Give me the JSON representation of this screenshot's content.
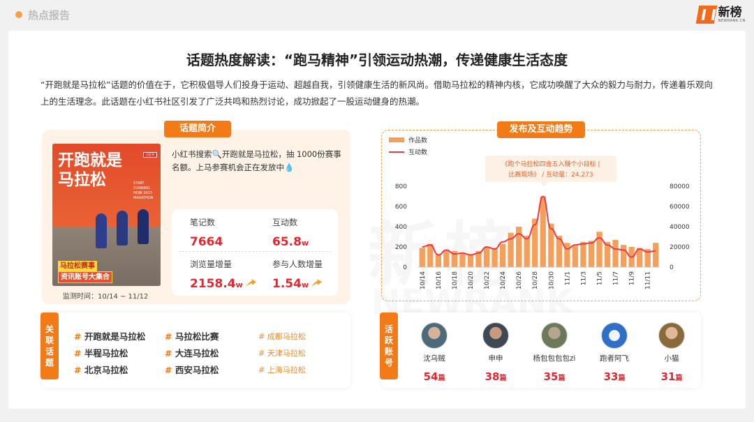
{
  "header": {
    "section_title": "热点报告",
    "logo_cn": "新榜",
    "logo_en": "NEWRANK.CN"
  },
  "watermark": {
    "cn": "新榜",
    "en": "NEWRANK"
  },
  "main": {
    "title": "话题热度解读：“跑马精神”引领运动热潮，传递健康生活态度",
    "intro": "“开跑就是马拉松”话题的价值在于，它积极倡导人们投身于运动、超越自我，引领健康生活的新风尚。借助马拉松的精神内核，它成功唤醒了大众的毅力与耐力，传递着乐观向上的生活理念。此话题在小红书社区引发了广泛共鸣和热烈讨论，成功掀起了一股运动健身的热潮。"
  },
  "topic": {
    "pill": "话题简介",
    "poster_title": "开跑就是马拉松",
    "poster_mini": "START RUNNING NOW 2023 MARATHON",
    "poster_badge": "小红书",
    "poster_tag1": "马拉松赛事",
    "poster_tag2": "资讯账号大集合",
    "search_text": "小红书搜索🔍开跑就是马拉松，抽 1000份赛事名额。上马参赛机会正在发放中💧",
    "monitor": "监测时间：10/14 ~ 11/12",
    "stats": [
      {
        "label": "笔记数",
        "value": "7664",
        "unit": ""
      },
      {
        "label": "互动数",
        "value": "65.8",
        "unit": "w"
      },
      {
        "label": "浏览量增量",
        "value": "2158.4",
        "unit": "w"
      },
      {
        "label": "参与人数增量",
        "value": "1.54",
        "unit": "w"
      }
    ]
  },
  "trend": {
    "pill": "发布及互动趋势",
    "annotation_line1": "《跑个马拉松四舍五入赚个小目标 |",
    "annotation_line2": "比赛现场》",
    "annotation_sep": "/ 互动量：",
    "annotation_value": "24,273"
  },
  "chart_data": {
    "type": "bar",
    "legend": [
      "作品数",
      "互动数"
    ],
    "legend_position": "top-left",
    "x": [
      "10/14",
      "10/15",
      "10/16",
      "10/17",
      "10/18",
      "10/19",
      "10/20",
      "10/21",
      "10/22",
      "10/23",
      "10/24",
      "10/25",
      "10/26",
      "10/27",
      "10/28",
      "10/29",
      "10/30",
      "10/31",
      "11/1",
      "11/2",
      "11/3",
      "11/4",
      "11/5",
      "11/6",
      "11/7",
      "11/8",
      "11/9",
      "11/10",
      "11/11",
      "11/12"
    ],
    "x_tick_labels": [
      "10/14",
      "10/16",
      "10/18",
      "10/20",
      "10/22",
      "10/24",
      "10/26",
      "10/28",
      "10/30",
      "11/1",
      "11/3",
      "11/5",
      "11/7",
      "11/9",
      "11/11"
    ],
    "series": [
      {
        "name": "作品数",
        "axis": "left",
        "type": "bar",
        "color": "#f5a05a",
        "values": [
          190,
          230,
          130,
          160,
          160,
          140,
          130,
          160,
          200,
          190,
          230,
          340,
          400,
          310,
          480,
          700,
          430,
          310,
          240,
          210,
          250,
          260,
          350,
          250,
          270,
          220,
          200,
          190,
          180,
          240
        ]
      },
      {
        "name": "互动数",
        "axis": "right",
        "type": "line",
        "color": "#e83b4a",
        "values": [
          20000,
          22000,
          12000,
          17000,
          13000,
          14000,
          12000,
          14000,
          20000,
          18000,
          25000,
          28000,
          33000,
          28000,
          42000,
          70000,
          38000,
          28000,
          18000,
          22000,
          23000,
          24000,
          29000,
          22000,
          18000,
          17000,
          10000,
          18000,
          15000,
          16000
        ]
      }
    ],
    "y_left": {
      "range": [
        0,
        800
      ],
      "ticks": [
        0,
        200,
        400,
        600,
        800
      ]
    },
    "y_right": {
      "range": [
        0,
        80000
      ],
      "ticks": [
        0,
        20000,
        40000,
        60000,
        80000
      ]
    },
    "grid": false
  },
  "related": {
    "label": "关联话题",
    "bold": [
      "开跑就是马拉松",
      "半程马拉松",
      "北京马拉松",
      "马拉松比赛",
      "大连马拉松",
      "西安马拉松"
    ],
    "small": [
      "成都马拉松",
      "天津马拉松",
      "上海马拉松"
    ]
  },
  "active": {
    "label": "活跃账号",
    "unit": "篇",
    "accounts": [
      {
        "name": "沈乌贼",
        "count": "54"
      },
      {
        "name": "申申",
        "count": "38"
      },
      {
        "name": "杨包包包包zi",
        "count": "35"
      },
      {
        "name": "跑者阿飞",
        "count": "33"
      },
      {
        "name": "小猫",
        "count": "31"
      }
    ]
  }
}
